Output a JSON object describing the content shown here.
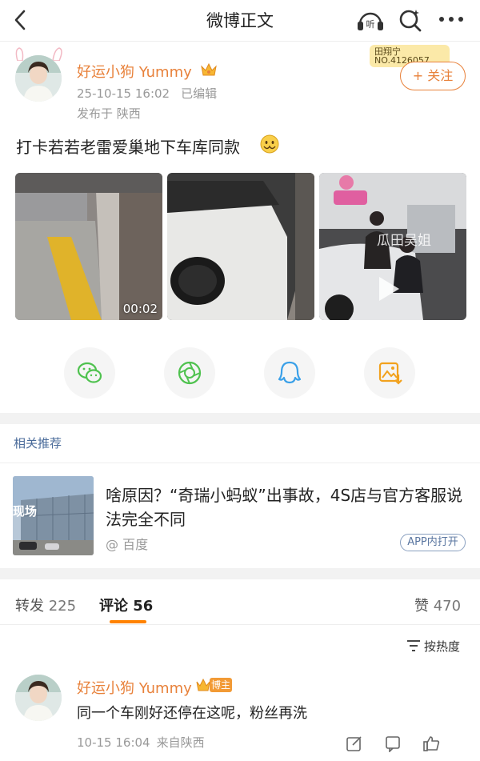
{
  "nav": {
    "title": "微博正文",
    "listen_label": "听"
  },
  "post": {
    "author": "好运小狗 Yummy",
    "time": "25-10-15 16:02",
    "edited": "已编辑",
    "published_from": "发布于 陕西",
    "fan_badge_name": "田翔宁",
    "fan_badge_number": "NO.4126057",
    "follow_label": "+ 关注",
    "text": "打卡若若老雷爱巢地下车库同款",
    "video_duration": "00:02",
    "image3_overlay": "瓜田吴姐"
  },
  "share": [
    "wechat-icon",
    "moments-icon",
    "qq-icon",
    "save-image-icon"
  ],
  "related": {
    "label": "相关推荐",
    "title": "啥原因？“奇瑞小蚂蚁”出事故，4S店与官方客服说法完全不同",
    "source": "@ 百度",
    "app_open": "APP内打开",
    "image_overlay": "现场"
  },
  "tabs": {
    "repost_label": "转发",
    "repost_count": "225",
    "comment_label": "评论",
    "comment_count": "56",
    "like_label": "赞",
    "like_count": "470"
  },
  "sort": {
    "label": "按热度"
  },
  "comment": {
    "author": "好运小狗 Yummy",
    "badge": "博主",
    "text": "同一个车刚好还停在这呢，粉丝再洗",
    "time": "10-15 16:04",
    "location": "来自陕西"
  },
  "colors": {
    "accent_orange": "#ff8200",
    "author_name": "#e8813a",
    "link_blue": "#4a6b9a",
    "muted": "#999999"
  }
}
